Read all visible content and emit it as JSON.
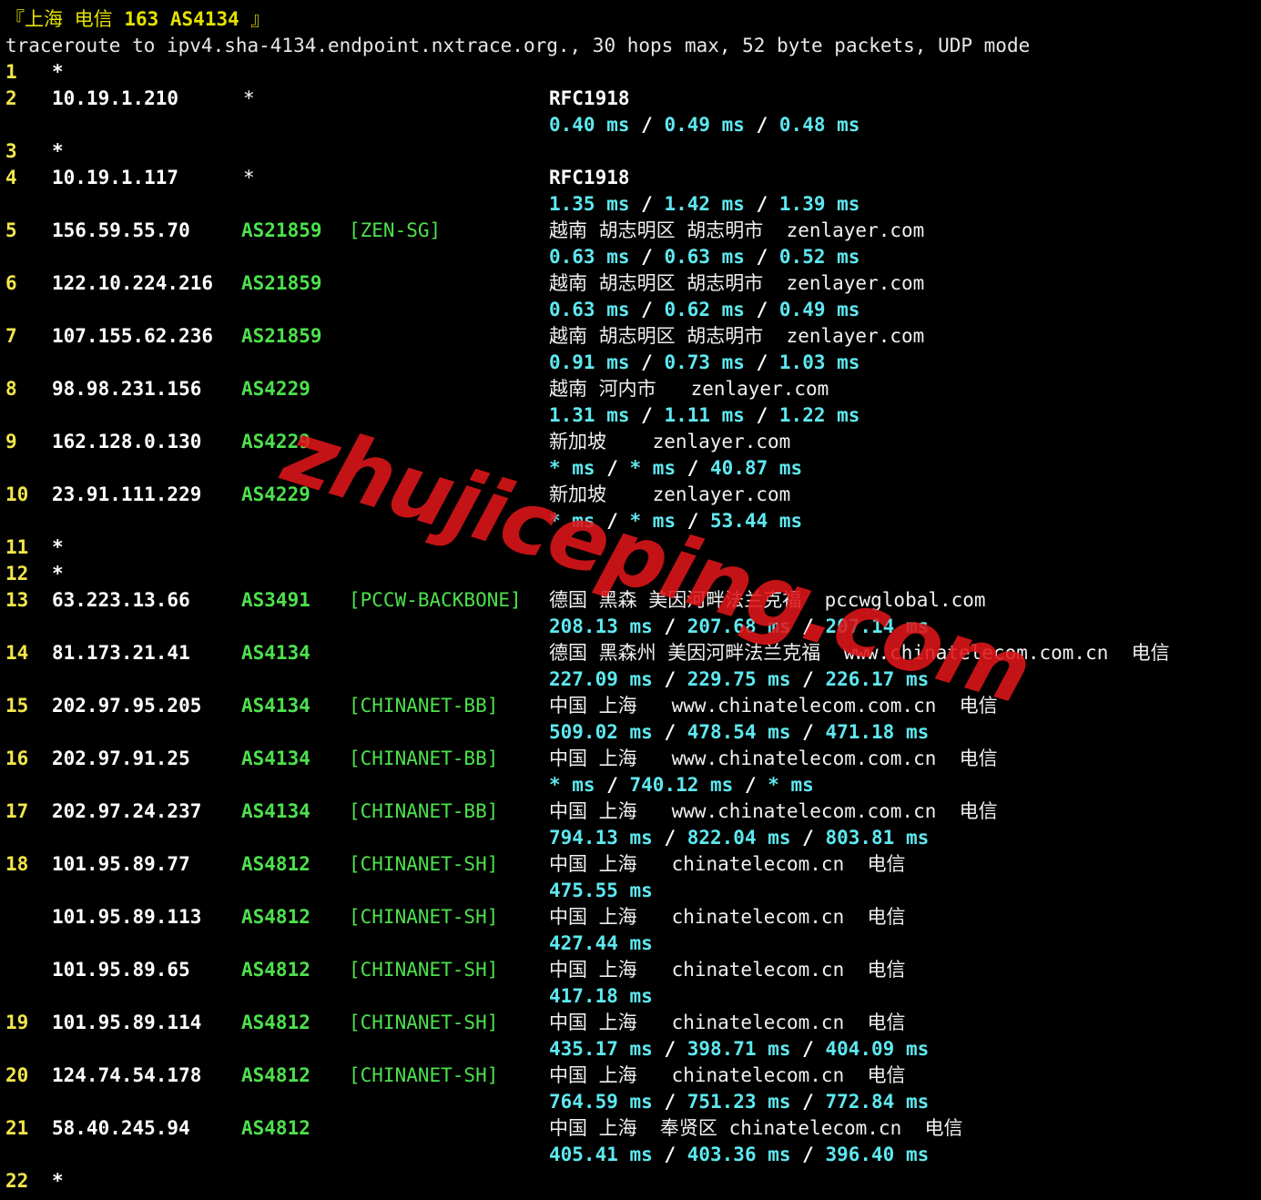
{
  "header": {
    "open_bracket": "『",
    "location": "上海 电信",
    "code": "163 AS4134",
    "close_bracket": "』"
  },
  "command_line": "traceroute to ipv4.sha-4134.endpoint.nxtrace.org., 30 hops max, 52 byte packets, UDP mode",
  "hops": [
    {
      "num": "1",
      "ip": "*"
    },
    {
      "num": "2",
      "ip": "10.19.1.210",
      "star": "*",
      "geo": "RFC1918",
      "rtt": [
        "0.40 ms",
        "0.49 ms",
        "0.48 ms"
      ]
    },
    {
      "num": "3",
      "ip": "*"
    },
    {
      "num": "4",
      "ip": "10.19.1.117",
      "star": "*",
      "geo": "RFC1918",
      "rtt": [
        "1.35 ms",
        "1.42 ms",
        "1.39 ms"
      ]
    },
    {
      "num": "5",
      "ip": "156.59.55.70",
      "asn": "AS21859",
      "tag": "[ZEN-SG]",
      "geo": "越南 胡志明区 胡志明市  zenlayer.com",
      "rtt": [
        "0.63 ms",
        "0.63 ms",
        "0.52 ms"
      ]
    },
    {
      "num": "6",
      "ip": "122.10.224.216",
      "asn": "AS21859",
      "geo": "越南 胡志明区 胡志明市  zenlayer.com",
      "rtt": [
        "0.63 ms",
        "0.62 ms",
        "0.49 ms"
      ]
    },
    {
      "num": "7",
      "ip": "107.155.62.236",
      "asn": "AS21859",
      "geo": "越南 胡志明区 胡志明市  zenlayer.com",
      "rtt": [
        "0.91 ms",
        "0.73 ms",
        "1.03 ms"
      ]
    },
    {
      "num": "8",
      "ip": "98.98.231.156",
      "asn": "AS4229",
      "geo": "越南 河内市   zenlayer.com",
      "rtt": [
        "1.31 ms",
        "1.11 ms",
        "1.22 ms"
      ]
    },
    {
      "num": "9",
      "ip": "162.128.0.130",
      "asn": "AS4229",
      "geo": "新加坡    zenlayer.com",
      "rtt": [
        "* ms",
        "* ms",
        "40.87 ms"
      ]
    },
    {
      "num": "10",
      "ip": "23.91.111.229",
      "asn": "AS4229",
      "geo": "新加坡    zenlayer.com",
      "rtt": [
        "* ms",
        "* ms",
        "53.44 ms"
      ]
    },
    {
      "num": "11",
      "ip": "*"
    },
    {
      "num": "12",
      "ip": "*"
    },
    {
      "num": "13",
      "ip": "63.223.13.66",
      "asn": "AS3491",
      "tag": "[PCCW-BACKBONE]",
      "geo": "德国 黑森 美因河畔法兰克福  pccwglobal.com",
      "rtt": [
        "208.13 ms",
        "207.68 ms",
        "207.14 ms"
      ]
    },
    {
      "num": "14",
      "ip": "81.173.21.41",
      "asn": "AS4134",
      "geo": "德国 黑森州 美因河畔法兰克福  www.chinatelecom.com.cn  电信",
      "rtt": [
        "227.09 ms",
        "229.75 ms",
        "226.17 ms"
      ]
    },
    {
      "num": "15",
      "ip": "202.97.95.205",
      "asn": "AS4134",
      "tag": "[CHINANET-BB]",
      "geo": "中国 上海   www.chinatelecom.com.cn  电信",
      "rtt": [
        "509.02 ms",
        "478.54 ms",
        "471.18 ms"
      ]
    },
    {
      "num": "16",
      "ip": "202.97.91.25",
      "asn": "AS4134",
      "tag": "[CHINANET-BB]",
      "geo": "中国 上海   www.chinatelecom.com.cn  电信",
      "rtt": [
        "* ms",
        "740.12 ms",
        "* ms"
      ]
    },
    {
      "num": "17",
      "ip": "202.97.24.237",
      "asn": "AS4134",
      "tag": "[CHINANET-BB]",
      "geo": "中国 上海   www.chinatelecom.com.cn  电信",
      "rtt": [
        "794.13 ms",
        "822.04 ms",
        "803.81 ms"
      ]
    },
    {
      "num": "18",
      "ip": "101.95.89.77",
      "asn": "AS4812",
      "tag": "[CHINANET-SH]",
      "geo": "中国 上海   chinatelecom.cn  电信",
      "rtt": [
        "475.55 ms"
      ]
    },
    {
      "num": "",
      "ip": "101.95.89.113",
      "asn": "AS4812",
      "tag": "[CHINANET-SH]",
      "geo": "中国 上海   chinatelecom.cn  电信",
      "rtt": [
        "427.44 ms"
      ]
    },
    {
      "num": "",
      "ip": "101.95.89.65",
      "asn": "AS4812",
      "tag": "[CHINANET-SH]",
      "geo": "中国 上海   chinatelecom.cn  电信",
      "rtt": [
        "417.18 ms"
      ]
    },
    {
      "num": "19",
      "ip": "101.95.89.114",
      "asn": "AS4812",
      "tag": "[CHINANET-SH]",
      "geo": "中国 上海   chinatelecom.cn  电信",
      "rtt": [
        "435.17 ms",
        "398.71 ms",
        "404.09 ms"
      ]
    },
    {
      "num": "20",
      "ip": "124.74.54.178",
      "asn": "AS4812",
      "tag": "[CHINANET-SH]",
      "geo": "中国 上海   chinatelecom.cn  电信",
      "rtt": [
        "764.59 ms",
        "751.23 ms",
        "772.84 ms"
      ]
    },
    {
      "num": "21",
      "ip": "58.40.245.94",
      "asn": "AS4812",
      "geo": "中国 上海  奉贤区 chinatelecom.cn  电信",
      "rtt": [
        "405.41 ms",
        "403.36 ms",
        "396.40 ms"
      ]
    },
    {
      "num": "22",
      "ip": "*"
    }
  ],
  "rtt_separator": " / ",
  "watermark": "zhujiceping.com",
  "colors": {
    "background": "#000000",
    "hop_number": "#f2e64a",
    "asn": "#4de14d",
    "rtt": "#5ee8f0",
    "watermark": "#e0161a"
  }
}
